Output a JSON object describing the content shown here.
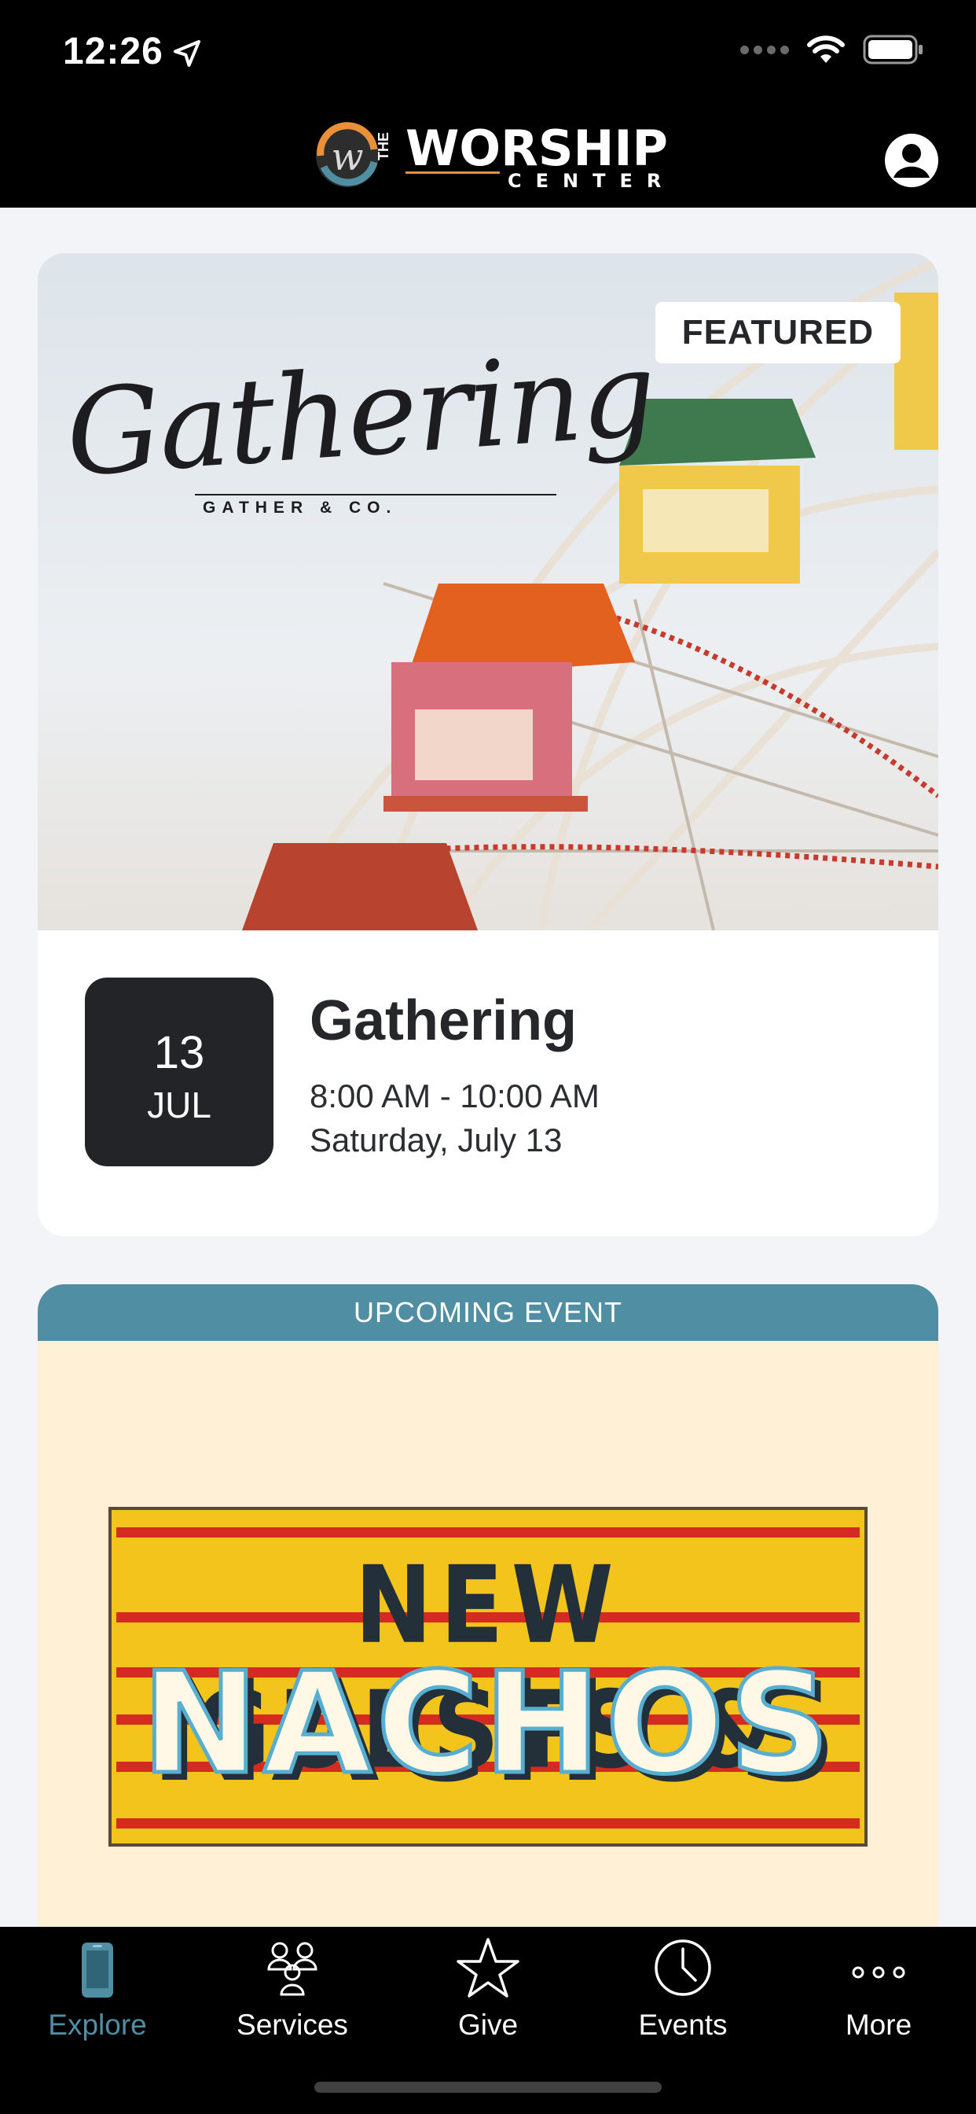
{
  "status_bar": {
    "time": "12:26"
  },
  "header": {
    "logo_alt": "THE WORSHIP CENTER",
    "logo_the": "THE",
    "logo_worship": "WORSHIP",
    "logo_center": "CENTER"
  },
  "featured": {
    "badge": "FEATURED",
    "image_script_title": "Gathering",
    "image_script_subtitle": "GATHER & CO.",
    "date_day": "13",
    "date_month": "JUL",
    "title": "Gathering",
    "time_range": "8:00 AM - 10:00 AM",
    "date_text": "Saturday, July 13"
  },
  "upcoming": {
    "header": "UPCOMING EVENT",
    "sign_line1": "NEW GUESTS &",
    "sign_line2": "NACHOS"
  },
  "tabs": [
    {
      "label": "Explore",
      "icon": "phone-icon",
      "active": true
    },
    {
      "label": "Services",
      "icon": "people-icon",
      "active": false
    },
    {
      "label": "Give",
      "icon": "star-icon",
      "active": false
    },
    {
      "label": "Events",
      "icon": "clock-icon",
      "active": false
    },
    {
      "label": "More",
      "icon": "more-dots-icon",
      "active": false
    }
  ],
  "colors": {
    "accent": "#4f8ea3",
    "dark_tile": "#232428",
    "upcoming_bg": "#fff0d6"
  }
}
